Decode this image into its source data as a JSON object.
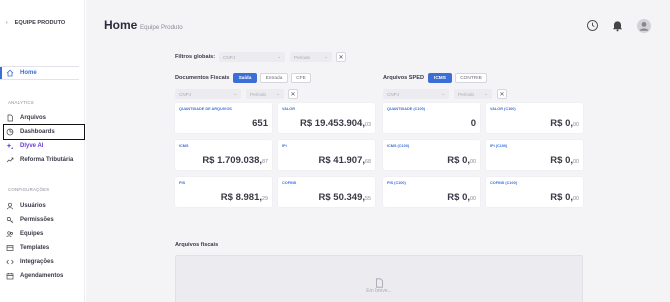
{
  "sidebar": {
    "team": "EQUIPE PRODUTO",
    "home": "Home",
    "analytics_section": "ANALYTICS",
    "arquivos": "Arquivos",
    "dashboards": "Dashboards",
    "dlyve": "Dlyve AI",
    "reforma": "Reforma Tributária",
    "config_section": "CONFIGURAÇÕES",
    "usuarios": "Usuários",
    "permissoes": "Permissões",
    "equipes": "Equipes",
    "templates": "Templates",
    "integracoes": "Integrações",
    "agendamentos": "Agendamentos"
  },
  "header": {
    "title": "Home",
    "subtitle": "Equipe Produto"
  },
  "filters": {
    "label": "Filtros globais:",
    "cnpj_placeholder": "CNPJ",
    "periodo_placeholder": "Período",
    "clear": "✕"
  },
  "docs": {
    "title": "Documentos Fiscais",
    "tabs": [
      "Saída",
      "Entrada",
      "CFE"
    ],
    "cnpj_placeholder": "CNPJ",
    "periodo_placeholder": "Período",
    "clear": "✕",
    "cards": [
      {
        "label": "QUANTIDADE DE ARQUIVOS",
        "value": "651",
        "cents": ""
      },
      {
        "label": "VALOR",
        "value": "R$ 19.453.904,",
        "cents": "03"
      },
      {
        "label": "ICMS",
        "value": "R$ 1.709.038,",
        "cents": "87"
      },
      {
        "label": "IPI",
        "value": "R$ 41.907,",
        "cents": "68"
      },
      {
        "label": "PIS",
        "value": "R$ 8.981,",
        "cents": "29"
      },
      {
        "label": "COFINS",
        "value": "R$ 50.349,",
        "cents": "55"
      }
    ]
  },
  "sped": {
    "title": "Arquivos SPED",
    "tabs": [
      "ICMS",
      "CONTRIB"
    ],
    "cnpj_placeholder": "CNPJ",
    "periodo_placeholder": "Período",
    "clear": "✕",
    "cards": [
      {
        "label": "QUANTIDADE (C100)",
        "value": "0",
        "cents": ""
      },
      {
        "label": "VALOR (C100)",
        "value": "R$ 0,",
        "cents": "00"
      },
      {
        "label": "ICMS (C100)",
        "value": "R$ 0,",
        "cents": "00"
      },
      {
        "label": "IPI (C100)",
        "value": "R$ 0,",
        "cents": "00"
      },
      {
        "label": "PIS (C100)",
        "value": "R$ 0,",
        "cents": "00"
      },
      {
        "label": "COFINS (C100)",
        "value": "R$ 0,",
        "cents": "00"
      }
    ]
  },
  "arquivos_fiscais": {
    "title": "Arquivos fiscais",
    "empty_text": "Em breve..."
  },
  "icons": [
    "history-icon",
    "bell-icon",
    "user-avatar-icon"
  ],
  "colors": {
    "accent": "#3b6fd6",
    "dlyve": "#6a3fd4"
  }
}
